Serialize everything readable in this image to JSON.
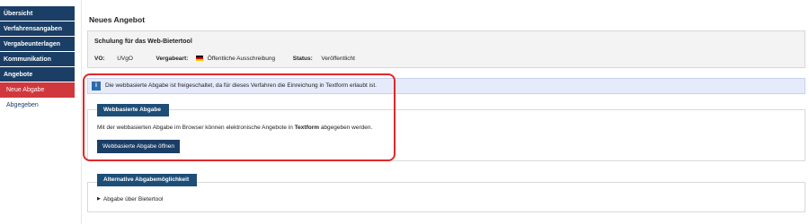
{
  "sidebar": {
    "items": [
      {
        "label": "Übersicht"
      },
      {
        "label": "Verfahrensangaben"
      },
      {
        "label": "Vergabeunterlagen"
      },
      {
        "label": "Kommunikation"
      },
      {
        "label": "Angebote"
      }
    ],
    "subitems": [
      {
        "label": "Neue Abgabe",
        "active": true
      },
      {
        "label": "Abgegeben",
        "active": false
      }
    ]
  },
  "main": {
    "page_title": "Neues Angebot",
    "procedure": {
      "name": "Schulung für das Web-Bietertool",
      "vo_label": "VO:",
      "vo_value": "UVgO",
      "vergabeart_label": "Vergabeart:",
      "vergabeart_value": "Öffentliche Ausschreibung",
      "status_label": "Status:",
      "status_value": "Veröffentlicht"
    },
    "notice_icon": "info-icon",
    "notice_text": "Die webbasierte Abgabe ist freigeschaltet, da für dieses Verfahren die Einreichung in Textform erlaubt ist.",
    "web_section": {
      "tab_label": "Webbasierte Abgabe",
      "desc_pre": "Mit der webbasierten Abgabe im Browser können elektronische Angebote in ",
      "desc_bold": "Textform",
      "desc_post": " abgegeben werden.",
      "button_label": "Webbasierte Abgabe öffnen"
    },
    "alt_section": {
      "tab_label": "Alternative Abgabemöglichkeit",
      "expander_label": "Abgabe über Bietertool"
    }
  },
  "colors": {
    "nav": "#1b3e66",
    "active": "#d0383e",
    "notice_bg": "#e6ebfc",
    "highlight": "#e0282a"
  }
}
